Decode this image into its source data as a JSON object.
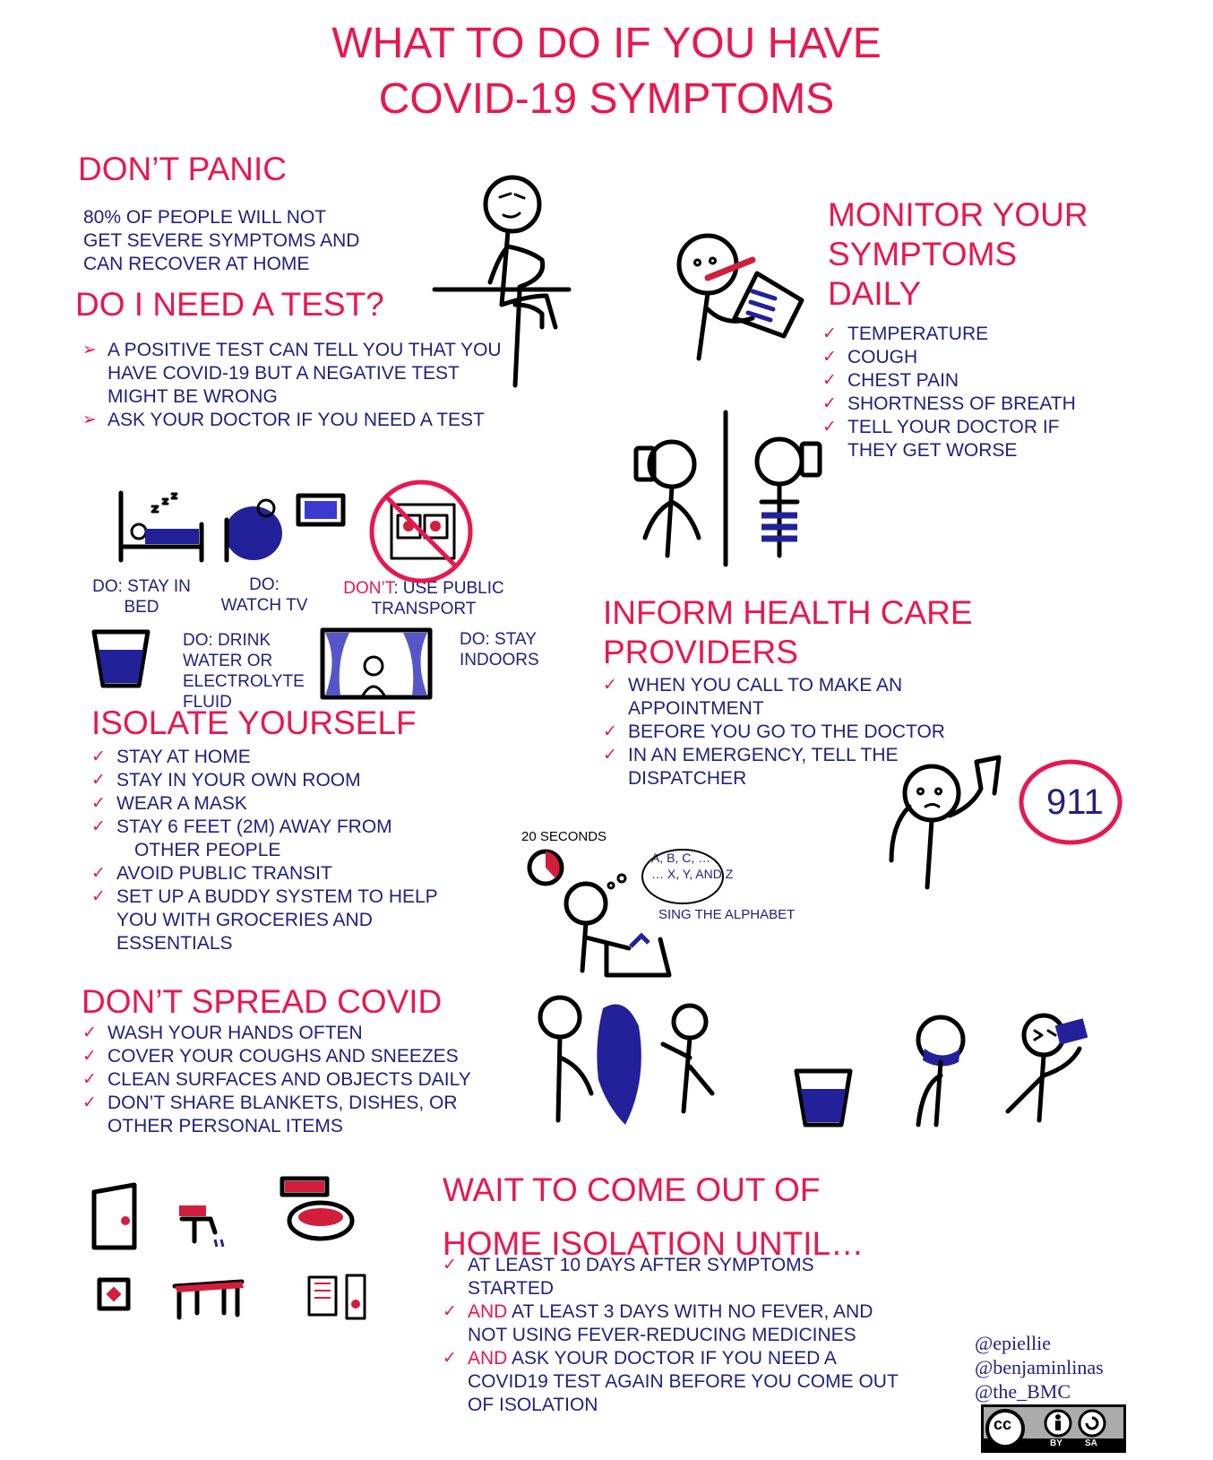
{
  "title": {
    "line1": "WHAT TO DO IF YOU HAVE",
    "line2": "COVID-19 SYMPTOMS"
  },
  "dont_panic": {
    "heading": "DON’T PANIC",
    "lines": [
      "80% OF PEOPLE WILL NOT",
      "GET SEVERE SYMPTOMS AND",
      "CAN RECOVER AT HOME"
    ]
  },
  "need_test": {
    "heading": "DO I NEED A TEST?",
    "items": [
      {
        "lines": [
          "A POSITIVE TEST CAN TELL YOU THAT YOU",
          "HAVE COVID-19 BUT A NEGATIVE TEST",
          "MIGHT BE WRONG"
        ]
      },
      {
        "lines": [
          "ASK YOUR DOCTOR IF YOU NEED A TEST"
        ]
      }
    ]
  },
  "monitor": {
    "heading_lines": [
      "MONITOR YOUR",
      "SYMPTOMS",
      "DAILY"
    ],
    "items": [
      {
        "lines": [
          "TEMPERATURE"
        ]
      },
      {
        "lines": [
          "COUGH"
        ]
      },
      {
        "lines": [
          "CHEST PAIN"
        ]
      },
      {
        "lines": [
          "SHORTNESS OF BREATH"
        ]
      },
      {
        "lines": [
          "TELL YOUR DOCTOR IF",
          "THEY GET WORSE"
        ]
      }
    ]
  },
  "captions": {
    "stay_in_bed": [
      "DO: STAY IN",
      "BED"
    ],
    "watch_tv": [
      "DO:",
      "WATCH TV"
    ],
    "public_transport": {
      "prefix": "DON’T",
      "rest": ": USE PUBLIC",
      "line2": "TRANSPORT"
    },
    "drink": [
      "DO: DRINK",
      "WATER OR",
      "ELECTROLYTE",
      "FLUID"
    ],
    "stay_indoors": [
      "DO: STAY",
      "INDOORS"
    ],
    "seconds": "20 SECONDS",
    "alphabet_bubble": [
      "A, B, C, …",
      "… X, Y, AND Z"
    ],
    "sing": "SING THE ALPHABET",
    "emergency_number": "911"
  },
  "isolate": {
    "heading": "ISOLATE YOURSELF",
    "items": [
      {
        "lines": [
          "STAY AT HOME"
        ]
      },
      {
        "lines": [
          "STAY IN YOUR OWN ROOM"
        ]
      },
      {
        "lines": [
          "WEAR A MASK"
        ]
      },
      {
        "lines": [
          "STAY 6 FEET (2M) AWAY FROM",
          "OTHER PEOPLE"
        ]
      },
      {
        "lines": [
          "AVOID PUBLIC TRANSIT"
        ]
      },
      {
        "lines": [
          "SET UP A BUDDY SYSTEM TO HELP",
          "YOU WITH GROCERIES AND",
          "ESSENTIALS"
        ]
      }
    ]
  },
  "inform": {
    "heading_lines": [
      "INFORM HEALTH CARE",
      "PROVIDERS"
    ],
    "items": [
      {
        "lines": [
          "WHEN YOU CALL TO MAKE AN",
          "APPOINTMENT"
        ]
      },
      {
        "lines": [
          "BEFORE YOU GO TO THE DOCTOR"
        ]
      },
      {
        "lines": [
          "IN AN EMERGENCY, TELL THE",
          "DISPATCHER"
        ]
      }
    ]
  },
  "spread": {
    "heading": "DON’T SPREAD COVID",
    "items": [
      {
        "lines": [
          "WASH YOUR HANDS OFTEN"
        ]
      },
      {
        "lines": [
          "COVER YOUR COUGHS AND SNEEZES"
        ]
      },
      {
        "lines": [
          "CLEAN SURFACES AND OBJECTS DAILY"
        ]
      },
      {
        "lines": [
          "DON’T SHARE BLANKETS, DISHES, OR",
          "OTHER PERSONAL ITEMS"
        ]
      }
    ]
  },
  "wait": {
    "heading_lines": [
      "WAIT TO COME OUT OF",
      "HOME ISOLATION UNTIL…"
    ],
    "items": [
      {
        "prefix": "",
        "lines": [
          "AT LEAST 10 DAYS AFTER  SYMPTOMS",
          "STARTED"
        ]
      },
      {
        "prefix": "AND",
        "lines": [
          " AT LEAST 3 DAYS WITH NO FEVER, AND",
          "NOT USING FEVER-REDUCING MEDICINES"
        ]
      },
      {
        "prefix": "AND",
        "lines": [
          " ASK YOUR DOCTOR IF YOU NEED A",
          "COVID19 TEST AGAIN BEFORE YOU COME OUT",
          "OF ISOLATION"
        ]
      }
    ]
  },
  "credits": [
    "@epiellie",
    "@benjaminlinas",
    "@the_BMC"
  ],
  "license": {
    "cc": "cc",
    "by": "BY",
    "sa": "SA"
  },
  "colors": {
    "accent": "#e8174f",
    "text": "#22207e"
  },
  "marks": {
    "check": "✓",
    "arrow": "➢"
  }
}
